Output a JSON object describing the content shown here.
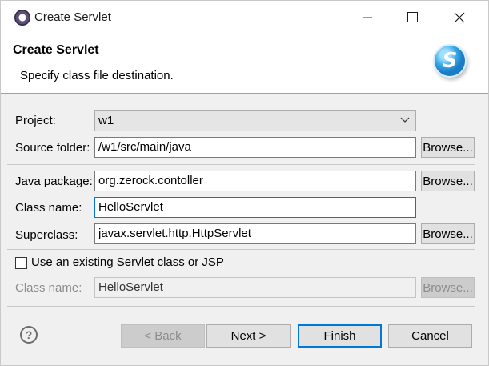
{
  "window": {
    "title": "Create Servlet",
    "icon": "eclipse-icon"
  },
  "banner": {
    "title": "Create Servlet",
    "description": "Specify class file destination.",
    "logo_letter": "S"
  },
  "form": {
    "project": {
      "label": "Project:",
      "value": "w1"
    },
    "source_folder": {
      "label": "Source folder:",
      "value": "/w1/src/main/java",
      "button": "Browse..."
    },
    "java_package": {
      "label": "Java package:",
      "value": "org.zerock.contoller",
      "button": "Browse..."
    },
    "class_name": {
      "label": "Class name:",
      "value": "HelloServlet"
    },
    "superclass": {
      "label": "Superclass:",
      "value": "javax.servlet.http.HttpServlet",
      "button": "Browse..."
    },
    "use_existing": {
      "label": "Use an existing Servlet class or JSP",
      "checked": false
    },
    "existing_class": {
      "label": "Class name:",
      "value": "HelloServlet",
      "button": "Browse..."
    }
  },
  "footer": {
    "help": "?",
    "back": "< Back",
    "next": "Next >",
    "finish": "Finish",
    "cancel": "Cancel"
  },
  "colors": {
    "accent": "#0078d7",
    "background": "#f0f0f0",
    "disabled_text": "#8d8d8d"
  }
}
